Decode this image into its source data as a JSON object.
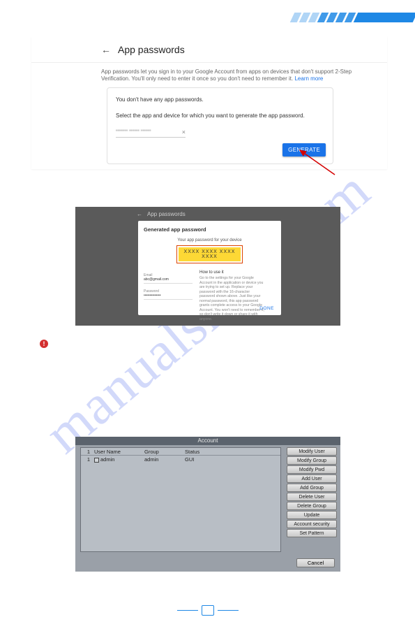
{
  "header": {
    "brand": ""
  },
  "shot1": {
    "title": "App passwords",
    "subtitle_a": "App passwords let you sign in to your Google Account from apps on devices that don't support 2-Step Verification. You'll only need to enter it once so you don't need to remember it.",
    "learn_more": "Learn more",
    "line1": "You don't have any app passwords.",
    "line2": "Select the app and device for which you want to generate the app password.",
    "input_value": "••••••• •••••• ••••••",
    "clear_x": "×",
    "generate": "GENERATE"
  },
  "shot2": {
    "header": "App passwords",
    "title": "Generated app password",
    "label": "Your app password for your device",
    "password": "XXXX XXXX XXXX XXXX",
    "how": "How to use it",
    "body": "Go to the settings for your Google Account in the application or device you are trying to set up. Replace your password with the 16-character password shown above. Just like your normal password, this app password grants complete access to your Google Account. You won't need to remember it, so don't write it down or share it with anyone.",
    "done": "DONE",
    "email_label": "Email",
    "email_value": "abc@gmail.com",
    "pw_label": "Password",
    "pw_value": "••••••••••••••"
  },
  "shot3": {
    "title": "Account",
    "columns": {
      "n": "1",
      "user": "User Name",
      "group": "Group",
      "status": "Status"
    },
    "rows": [
      {
        "n": "1",
        "user": "admin",
        "group": "admin",
        "status": "GUI"
      }
    ],
    "buttons": [
      "Modify User",
      "Modify Group",
      "Modify Pwd",
      "Add User",
      "Add Group",
      "Delete User",
      "Delete Group",
      "Update",
      "Account security",
      "Set Pattern"
    ],
    "cancel": "Cancel"
  },
  "warning_glyph": "!",
  "watermark": "manualshive.com"
}
